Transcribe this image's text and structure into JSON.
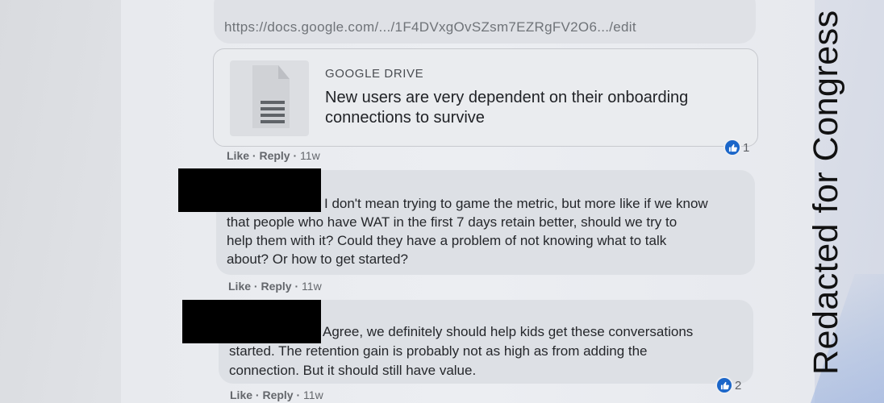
{
  "watermark": {
    "text": "Redacted for Congress"
  },
  "link_preview": {
    "top_link": "https://docs.google.com/.../1F4DVxgOvSZsm7EZRgFV2O6.../edit",
    "source": "GOOGLE DRIVE",
    "title": "New users are very dependent on their onboarding connections to survive",
    "icon": "document-icon"
  },
  "comments": [
    {
      "author_redacted": true,
      "text": "I don't mean trying to game the metric, but more like if we know that people who have WAT in the first 7 days retain better, should we try to help them with it? Could they have a problem of not knowing what to talk about? Or how to get started?",
      "lines": [
        "I don't mean trying to game the metric, but more like if we know",
        "that people who have WAT in the first 7 days retain better, should we try to",
        "help them with it? Could they have a problem of not knowing what to talk",
        "about? Or how to get started?"
      ],
      "like_label": "Like",
      "reply_label": "Reply",
      "time": "11w"
    },
    {
      "author_redacted": true,
      "lines": [
        "Agree, we definitely should help kids get these conversations",
        "started. The retention gain is probably not as high as from adding the",
        "connection. But it should still have value."
      ],
      "like_label": "Like",
      "reply_label": "Reply",
      "time": "11w",
      "reaction_count": "2",
      "reaction_icon": "thumbs-up-icon"
    }
  ],
  "preview_actions": {
    "like_label": "Like",
    "reply_label": "Reply",
    "time": "11w",
    "reaction_count": "1",
    "reaction_icon": "thumbs-up-icon"
  },
  "separator": "·",
  "colors": {
    "reaction_blue": "#1b66c9",
    "redaction": "#000000"
  }
}
